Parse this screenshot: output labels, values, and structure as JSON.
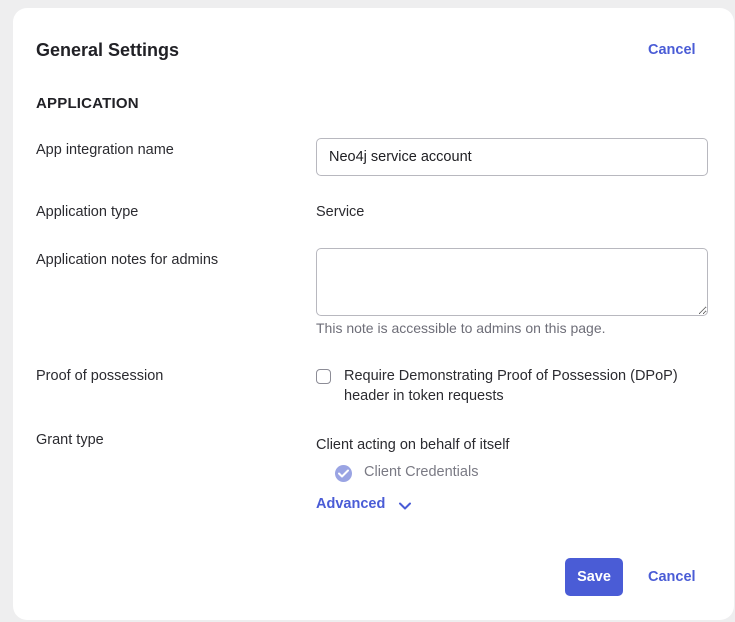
{
  "header": {
    "title": "General Settings",
    "cancel_label": "Cancel"
  },
  "section": {
    "title": "APPLICATION"
  },
  "fields": {
    "app_name": {
      "label": "App integration name",
      "value": "Neo4j service account"
    },
    "app_type": {
      "label": "Application type",
      "value": "Service"
    },
    "notes": {
      "label": "Application notes for admins",
      "value": "",
      "hint": "This note is accessible to admins on this page."
    },
    "proof": {
      "label": "Proof of possession",
      "checkbox_label": "Require Demonstrating Proof of Possession (DPoP) header in token requests",
      "checked": false
    },
    "grant": {
      "label": "Grant type",
      "heading": "Client acting on behalf of itself",
      "option_label": "Client Credentials",
      "option_checked": true,
      "advanced_label": "Advanced"
    }
  },
  "footer": {
    "save_label": "Save",
    "cancel_label": "Cancel"
  },
  "colors": {
    "accent": "#4a5cd6",
    "checked_disabled": "#9aa4e3"
  }
}
